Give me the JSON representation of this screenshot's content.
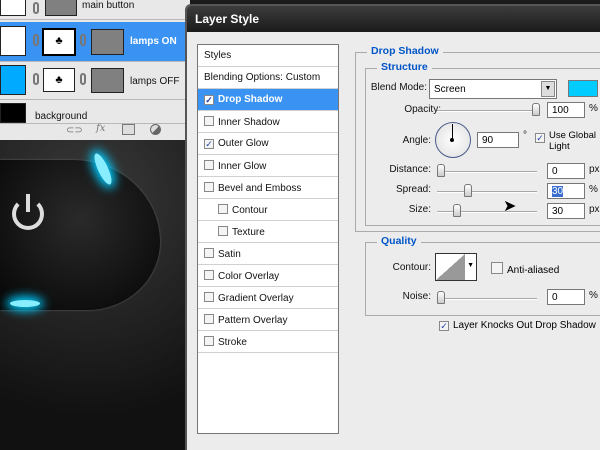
{
  "layers": [
    {
      "name": "main button"
    },
    {
      "name": "lamps ON"
    },
    {
      "name": "lamps OFF"
    },
    {
      "name": "background"
    }
  ],
  "layer_footer_icons": [
    "link-icon",
    "fx-icon",
    "mask-icon",
    "adjustment-icon"
  ],
  "dialog": {
    "title": "Layer Style"
  },
  "styles_list": {
    "header": "Styles",
    "blending": "Blending Options: Custom",
    "items": [
      {
        "label": "Drop Shadow",
        "checked": true,
        "selected": true
      },
      {
        "label": "Inner Shadow",
        "checked": false
      },
      {
        "label": "Outer Glow",
        "checked": true
      },
      {
        "label": "Inner Glow",
        "checked": false
      },
      {
        "label": "Bevel and Emboss",
        "checked": false
      },
      {
        "label": "Contour",
        "checked": false,
        "indent": true
      },
      {
        "label": "Texture",
        "checked": false,
        "indent": true
      },
      {
        "label": "Satin",
        "checked": false
      },
      {
        "label": "Color Overlay",
        "checked": false
      },
      {
        "label": "Gradient Overlay",
        "checked": false
      },
      {
        "label": "Pattern Overlay",
        "checked": false
      },
      {
        "label": "Stroke",
        "checked": false
      }
    ]
  },
  "drop_shadow": {
    "title": "Drop Shadow",
    "structure": "Structure",
    "blend_mode_label": "Blend Mode:",
    "blend_mode": "Screen",
    "color": "#00ccff",
    "opacity_label": "Opacity:",
    "opacity": "100",
    "opacity_unit": "%",
    "angle_label": "Angle:",
    "angle": "90",
    "angle_unit": "°",
    "use_global_light": "Use Global Light",
    "distance_label": "Distance:",
    "distance": "0",
    "distance_unit": "px",
    "spread_label": "Spread:",
    "spread": "30",
    "spread_unit": "%",
    "size_label": "Size:",
    "size": "30",
    "size_unit": "px"
  },
  "quality": {
    "title": "Quality",
    "contour_label": "Contour:",
    "anti_aliased": "Anti-aliased",
    "noise_label": "Noise:",
    "noise": "0",
    "noise_unit": "%",
    "knockout": "Layer Knocks Out Drop Shadow"
  }
}
